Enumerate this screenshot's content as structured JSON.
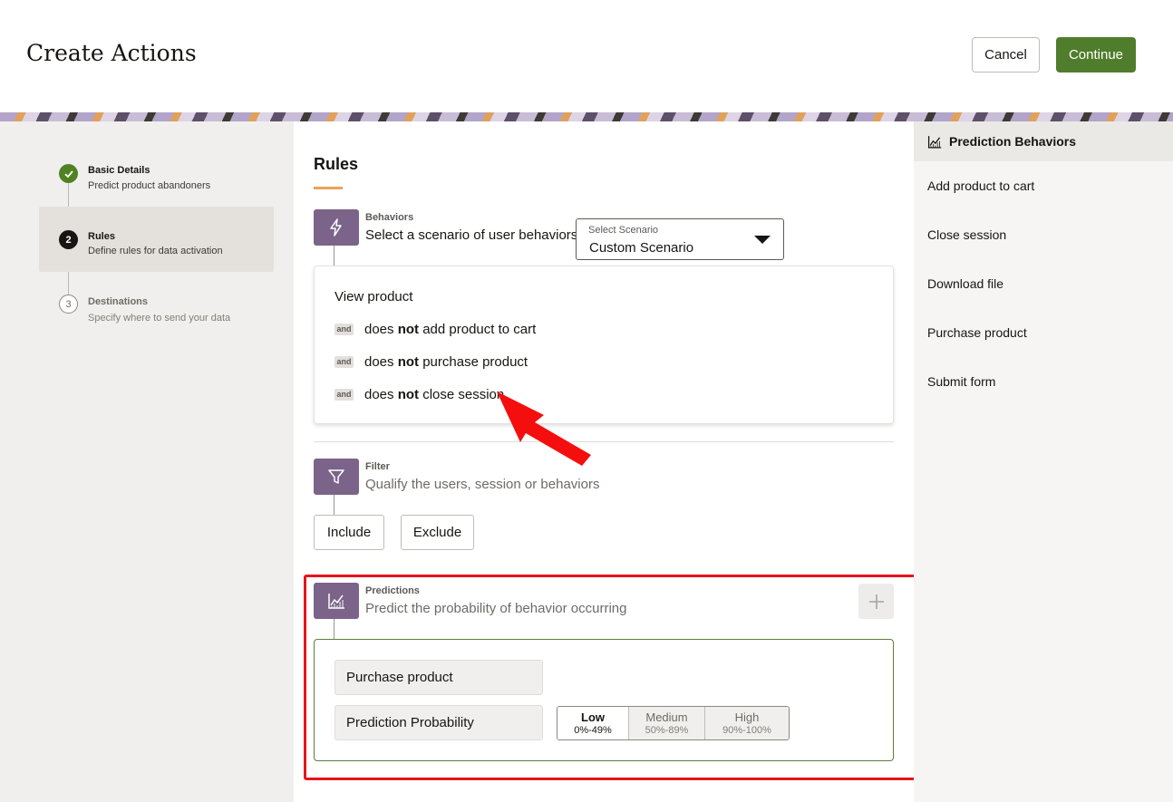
{
  "header": {
    "title": "Create Actions",
    "cancel_label": "Cancel",
    "continue_label": "Continue"
  },
  "colors": {
    "accent_green": "#4f7d2b",
    "section_purple": "#7b6389",
    "annotation_red": "#e8131b",
    "underline_orange": "#e8a45b"
  },
  "steps": [
    {
      "number": "",
      "title": "Basic Details",
      "subtitle": "Predict product abandoners",
      "state": "done",
      "icon": "check-icon"
    },
    {
      "number": "2",
      "title": "Rules",
      "subtitle": "Define rules for data activation",
      "state": "current"
    },
    {
      "number": "3",
      "title": "Destinations",
      "subtitle": "Specify where to send your data",
      "state": "todo"
    }
  ],
  "main": {
    "heading": "Rules",
    "behaviors": {
      "label": "Behaviors",
      "description": "Select a scenario of user behaviors",
      "icon": "lightning-icon",
      "select": {
        "label": "Select Scenario",
        "value": "Custom Scenario"
      },
      "first": "View product",
      "conditions": [
        {
          "connector": "and",
          "prefix": "does ",
          "emphasis": "not",
          "suffix": " add product to cart"
        },
        {
          "connector": "and",
          "prefix": "does ",
          "emphasis": "not",
          "suffix": " purchase product"
        },
        {
          "connector": "and",
          "prefix": "does ",
          "emphasis": "not",
          "suffix": " close session"
        }
      ]
    },
    "filter": {
      "label": "Filter",
      "description": "Qualify the users, session or behaviors",
      "icon": "funnel-icon",
      "include_label": "Include",
      "exclude_label": "Exclude"
    },
    "predictions": {
      "label": "Predictions",
      "description": "Predict the probability of behavior occurring",
      "icon": "chart-icon",
      "add_icon": "plus-icon",
      "behavior_value": "Purchase product",
      "probability_label": "Prediction Probability",
      "levels": [
        {
          "name": "Low",
          "range": "0%-49%",
          "selected": true
        },
        {
          "name": "Medium",
          "range": "50%-89%",
          "selected": false
        },
        {
          "name": "High",
          "range": "90%-100%",
          "selected": false
        }
      ]
    }
  },
  "right_panel": {
    "title": "Prediction Behaviors",
    "icon": "chart-icon",
    "items": [
      "Add product to cart",
      "Close session",
      "Download file",
      "Purchase product",
      "Submit form"
    ]
  }
}
